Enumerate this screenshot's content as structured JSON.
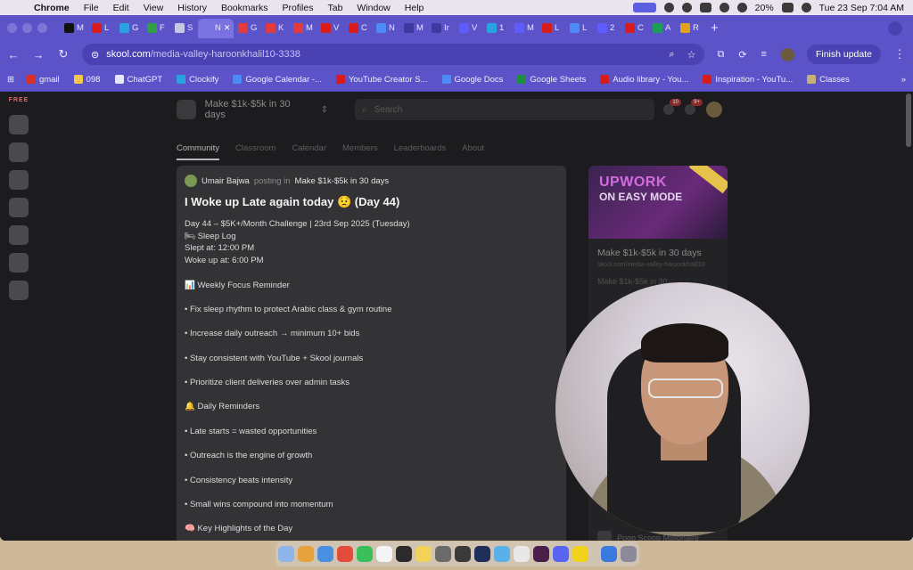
{
  "menubar": {
    "app": "Chrome",
    "items": [
      "File",
      "Edit",
      "View",
      "History",
      "Bookmarks",
      "Profiles",
      "Tab",
      "Window",
      "Help"
    ],
    "battery": "20%",
    "clock": "Tue 23 Sep  7:04 AM"
  },
  "tabs": [
    {
      "label": "M",
      "color": "#111111"
    },
    {
      "label": "L",
      "color": "#d81b1b"
    },
    {
      "label": "G",
      "color": "#2aa1e0"
    },
    {
      "label": "F",
      "color": "#2f9e44"
    },
    {
      "label": "S",
      "color": "#c7c7e8"
    },
    {
      "label": "N",
      "color": "#7a72e0"
    },
    {
      "label": "G",
      "color": "#e23b3b"
    },
    {
      "label": "K",
      "color": "#e23b3b"
    },
    {
      "label": "M",
      "color": "#e23b3b"
    },
    {
      "label": "V",
      "color": "#d81b1b"
    },
    {
      "label": "C",
      "color": "#d81b1b"
    },
    {
      "label": "N",
      "color": "#4c8bf5"
    },
    {
      "label": "M",
      "color": "#3a3aa0"
    },
    {
      "label": "Ir",
      "color": "#3a3aa0"
    },
    {
      "label": "V",
      "color": "#5c5cff"
    },
    {
      "label": "1",
      "color": "#2aa1e0"
    },
    {
      "label": "M",
      "color": "#5c5cff"
    },
    {
      "label": "L",
      "color": "#d81b1b"
    },
    {
      "label": "L",
      "color": "#4c8bf5"
    },
    {
      "label": "2",
      "color": "#5c5cff"
    },
    {
      "label": "C",
      "color": "#d81b1b"
    },
    {
      "label": "A",
      "color": "#1a9e5a"
    },
    {
      "label": "R",
      "color": "#e2a21b"
    }
  ],
  "active_tab_index": 5,
  "toolbar": {
    "url_host": "skool.com",
    "url_path": "/media-valley-haroonkhalil10-3338",
    "finish_update": "Finish update"
  },
  "bookmarks": [
    {
      "label": "gmail",
      "color": "#d93025"
    },
    {
      "label": "098",
      "color": "#f2c94c"
    },
    {
      "label": "ChatGPT",
      "color": "#e8e6ff"
    },
    {
      "label": "Clockify",
      "color": "#2aa1e0"
    },
    {
      "label": "Google Calendar -...",
      "color": "#4c8bf5"
    },
    {
      "label": "YouTube Creator S...",
      "color": "#d81b1b"
    },
    {
      "label": "Google Docs",
      "color": "#4c8bf5"
    },
    {
      "label": "Google Sheets",
      "color": "#1e8e3e"
    },
    {
      "label": "Audio library - You...",
      "color": "#d81b1b"
    },
    {
      "label": "Inspiration - YouTu...",
      "color": "#d81b1b"
    },
    {
      "label": "Classes",
      "color": "#c7b07a"
    }
  ],
  "skool": {
    "group_name": "Make $1k-$5k in 30 days",
    "search_placeholder": "Search",
    "chat_badge": "10",
    "notif_badge": "9+",
    "nav_tabs": [
      "Community",
      "Classroom",
      "Calendar",
      "Members",
      "Leaderboards",
      "About"
    ],
    "rail_label": "FREE",
    "post": {
      "author": "Umair Bajwa",
      "posting_in": "posting in",
      "group": "Make $1k-$5k in 30 days",
      "title": "I Woke up Late again today 😟 (Day 44)",
      "lines": [
        "Day 44 – $5K+/Month Challenge | 23rd Sep 2025 (Tuesday)",
        "🛏 Sleep Log",
        "Slept at: 12:00 PM",
        "Woke up at: 6:00 PM",
        "",
        "📊 Weekly Focus Reminder",
        "",
        "• Fix sleep rhythm to protect Arabic class & gym routine",
        "",
        "• Increase daily outreach → minimum 10+ bids",
        "",
        "• Stay consistent with YouTube + Skool journals",
        "",
        "• Prioritize client deliveries over admin tasks",
        "",
        "🔔 Daily Reminders",
        "",
        "• Late starts = wasted opportunities",
        "",
        "• Outreach is the engine of growth",
        "",
        "• Consistency beats intensity",
        "",
        "• Small wins compound into momentum",
        "",
        "🧠 Key Highlights of the Day"
      ]
    },
    "sidebar": {
      "banner_line1": "UPWORK",
      "banner_line2": "ON EASY MODE",
      "title": "Make $1k-$5k in 30 days",
      "url": "skool.com/media-valley-haroonkhalil10",
      "desc": "Make $1k-$5k in 30",
      "item": "Poop Scoop Millionaire"
    }
  },
  "dock_colors": [
    "#8fb4e8",
    "#e6a23c",
    "#4a8fe0",
    "#e34b3b",
    "#3bbf5a",
    "#f4f4f4",
    "#2b2b2b",
    "#f2d25a",
    "#6b6b6b",
    "#3a3a3a",
    "#1e2f5a",
    "#5ab0e8",
    "#e8e8e8",
    "#4a1f4a",
    "#5865f2",
    "#f2d21b",
    "#3a7adf",
    "#8a8a9a"
  ]
}
